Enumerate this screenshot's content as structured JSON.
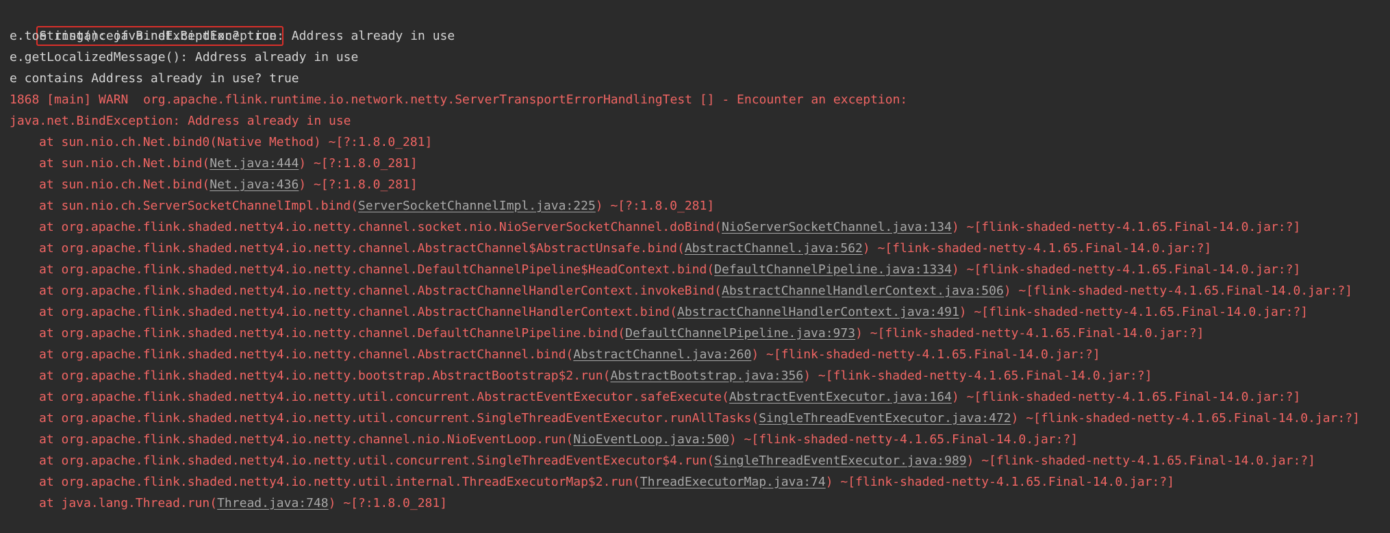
{
  "console": {
    "header_lines": [
      "e instanceof BindException? true",
      "e.toString(): java.net.BindException: Address already in use",
      "e.getLocalizedMessage(): Address already in use",
      "e contains Address already in use? true"
    ],
    "warn_line": "1868 [main] WARN  org.apache.flink.runtime.io.network.netty.ServerTransportErrorHandlingTest [] - Encounter an exception:",
    "exception_line": "java.net.BindException: Address already in use",
    "stack": [
      {
        "pre": "at sun.nio.ch.Net.bind0(Native Method) ~[?:1.8.0_281]",
        "link": "",
        "post": ""
      },
      {
        "pre": "at sun.nio.ch.Net.bind(",
        "link": "Net.java:444",
        "post": ") ~[?:1.8.0_281]"
      },
      {
        "pre": "at sun.nio.ch.Net.bind(",
        "link": "Net.java:436",
        "post": ") ~[?:1.8.0_281]"
      },
      {
        "pre": "at sun.nio.ch.ServerSocketChannelImpl.bind(",
        "link": "ServerSocketChannelImpl.java:225",
        "post": ") ~[?:1.8.0_281]"
      },
      {
        "pre": "at org.apache.flink.shaded.netty4.io.netty.channel.socket.nio.NioServerSocketChannel.doBind(",
        "link": "NioServerSocketChannel.java:134",
        "post": ") ~[flink-shaded-netty-4.1.65.Final-14.0.jar:?]"
      },
      {
        "pre": "at org.apache.flink.shaded.netty4.io.netty.channel.AbstractChannel$AbstractUnsafe.bind(",
        "link": "AbstractChannel.java:562",
        "post": ") ~[flink-shaded-netty-4.1.65.Final-14.0.jar:?]"
      },
      {
        "pre": "at org.apache.flink.shaded.netty4.io.netty.channel.DefaultChannelPipeline$HeadContext.bind(",
        "link": "DefaultChannelPipeline.java:1334",
        "post": ") ~[flink-shaded-netty-4.1.65.Final-14.0.jar:?]"
      },
      {
        "pre": "at org.apache.flink.shaded.netty4.io.netty.channel.AbstractChannelHandlerContext.invokeBind(",
        "link": "AbstractChannelHandlerContext.java:506",
        "post": ") ~[flink-shaded-netty-4.1.65.Final-14.0.jar:?]"
      },
      {
        "pre": "at org.apache.flink.shaded.netty4.io.netty.channel.AbstractChannelHandlerContext.bind(",
        "link": "AbstractChannelHandlerContext.java:491",
        "post": ") ~[flink-shaded-netty-4.1.65.Final-14.0.jar:?]"
      },
      {
        "pre": "at org.apache.flink.shaded.netty4.io.netty.channel.DefaultChannelPipeline.bind(",
        "link": "DefaultChannelPipeline.java:973",
        "post": ") ~[flink-shaded-netty-4.1.65.Final-14.0.jar:?]"
      },
      {
        "pre": "at org.apache.flink.shaded.netty4.io.netty.channel.AbstractChannel.bind(",
        "link": "AbstractChannel.java:260",
        "post": ") ~[flink-shaded-netty-4.1.65.Final-14.0.jar:?]"
      },
      {
        "pre": "at org.apache.flink.shaded.netty4.io.netty.bootstrap.AbstractBootstrap$2.run(",
        "link": "AbstractBootstrap.java:356",
        "post": ") ~[flink-shaded-netty-4.1.65.Final-14.0.jar:?]"
      },
      {
        "pre": "at org.apache.flink.shaded.netty4.io.netty.util.concurrent.AbstractEventExecutor.safeExecute(",
        "link": "AbstractEventExecutor.java:164",
        "post": ") ~[flink-shaded-netty-4.1.65.Final-14.0.jar:?]"
      },
      {
        "pre": "at org.apache.flink.shaded.netty4.io.netty.util.concurrent.SingleThreadEventExecutor.runAllTasks(",
        "link": "SingleThreadEventExecutor.java:472",
        "post": ") ~[flink-shaded-netty-4.1.65.Final-14.0.jar:?]"
      },
      {
        "pre": "at org.apache.flink.shaded.netty4.io.netty.channel.nio.NioEventLoop.run(",
        "link": "NioEventLoop.java:500",
        "post": ") ~[flink-shaded-netty-4.1.65.Final-14.0.jar:?]"
      },
      {
        "pre": "at org.apache.flink.shaded.netty4.io.netty.util.concurrent.SingleThreadEventExecutor$4.run(",
        "link": "SingleThreadEventExecutor.java:989",
        "post": ") ~[flink-shaded-netty-4.1.65.Final-14.0.jar:?]"
      },
      {
        "pre": "at org.apache.flink.shaded.netty4.io.netty.util.internal.ThreadExecutorMap$2.run(",
        "link": "ThreadExecutorMap.java:74",
        "post": ") ~[flink-shaded-netty-4.1.65.Final-14.0.jar:?]"
      },
      {
        "pre": "at java.lang.Thread.run(",
        "link": "Thread.java:748",
        "post": ") ~[?:1.8.0_281]"
      }
    ]
  },
  "colors": {
    "background": "#2b2b2b",
    "stdout_text": "#d4d4d4",
    "stderr_text": "#f06563",
    "link_text": "#a8a8a8",
    "highlight_border": "#d9302a"
  }
}
